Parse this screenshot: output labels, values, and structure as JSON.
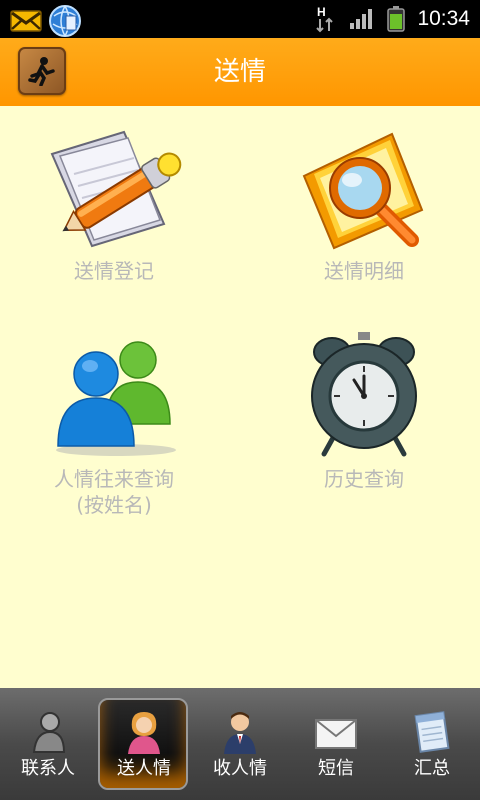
{
  "status_bar": {
    "time": "10:34",
    "network_label": "H"
  },
  "header": {
    "title": "送情"
  },
  "grid": {
    "items": [
      {
        "label": "送情登记",
        "icon": "pencil-document-icon"
      },
      {
        "label": "送情明细",
        "icon": "magnifier-document-icon"
      },
      {
        "label_line1": "人情往来查询",
        "label_line2": "(按姓名)",
        "icon": "people-icon"
      },
      {
        "label": "历史查询",
        "icon": "alarm-clock-icon"
      }
    ]
  },
  "tabs": [
    {
      "label": "联系人",
      "icon": "contact-person-icon"
    },
    {
      "label": "送人情",
      "icon": "female-user-icon",
      "active": true
    },
    {
      "label": "收人情",
      "icon": "male-user-icon"
    },
    {
      "label": "短信",
      "icon": "envelope-icon"
    },
    {
      "label": "汇总",
      "icon": "notepad-icon"
    }
  ],
  "colors": {
    "header": "#ff9a0a",
    "background": "#fffed0",
    "tabbar": "#4a4a4a",
    "label_text": "#b8b8b8"
  }
}
